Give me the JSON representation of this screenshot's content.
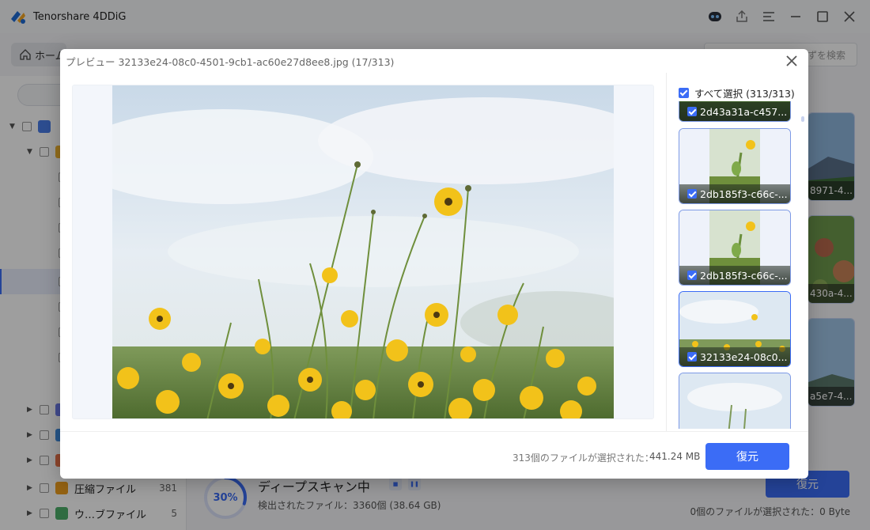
{
  "app": {
    "title": "Tenorshare 4DDiG",
    "home_tab": "ホーム",
    "search_placeholder": "ずを検索"
  },
  "sidebar": {
    "rows": [
      {
        "label": "",
        "count": ""
      },
      {
        "label": "",
        "count": ""
      },
      {
        "label": "圧縮ファイル",
        "count": "381"
      },
      {
        "label": "ウ…ブファイル",
        "count": "5"
      }
    ]
  },
  "scan": {
    "progress_label": "30%",
    "progress_value": 0.3,
    "title": "ディープスキャン中",
    "found": "検出されたファイル：3360個 (38.64 GB)",
    "recover_label": "復元",
    "selected_text": "0個のファイルが選択された：0 Byte"
  },
  "bg_thumbs": [
    {
      "caption": "8971-4..."
    },
    {
      "caption": "430a-4..."
    },
    {
      "caption": "a5e7-4..."
    }
  ],
  "modal": {
    "title": "プレビュー 32133e24-08c0-4501-9cb1-ac60e27d8ee8.jpg (17/313)",
    "select_all": "すべて選択 (313/313)",
    "thumbs": [
      {
        "caption": "2d43a31a-c457..."
      },
      {
        "caption": "2db185f3-c66c-..."
      },
      {
        "caption": "2db185f3-c66c-..."
      },
      {
        "caption": "32133e24-08c0..."
      },
      {
        "caption": ""
      }
    ],
    "footer_info": "313個のファイルが選択された：",
    "footer_size": "441.24 MB",
    "recover_label": "復元"
  },
  "colors": {
    "accent": "#3b6cf6",
    "flower_yellow": "#f2c21a",
    "sky": "#dfe9f2"
  }
}
